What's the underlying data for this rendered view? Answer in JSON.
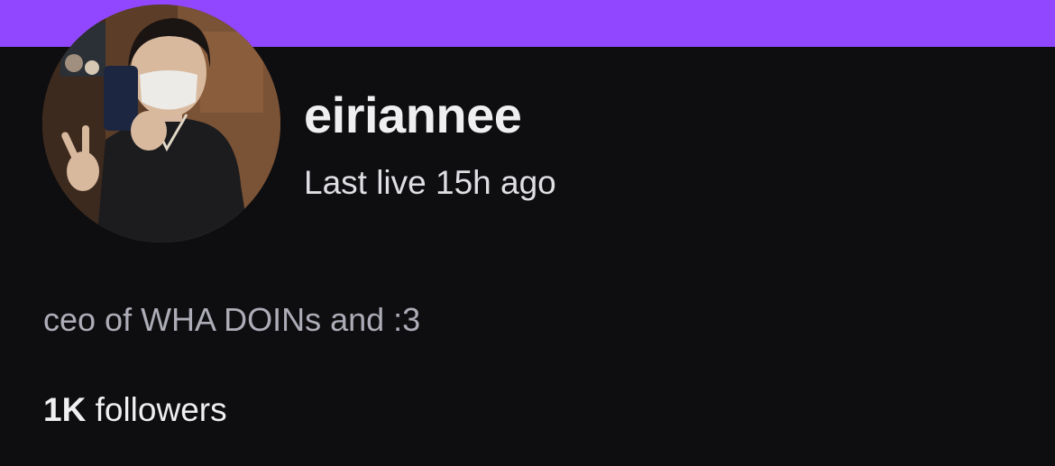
{
  "colors": {
    "banner": "#9147ff",
    "background": "#0e0e10",
    "primary_text": "#efeff1",
    "secondary_text": "#adadb8"
  },
  "profile": {
    "avatar_icon": "avatar-photo",
    "username": "eiriannee",
    "last_live": "Last live 15h ago",
    "bio": "ceo of WHA DOINs and :3",
    "followers_count": "1K",
    "followers_label": "followers"
  }
}
